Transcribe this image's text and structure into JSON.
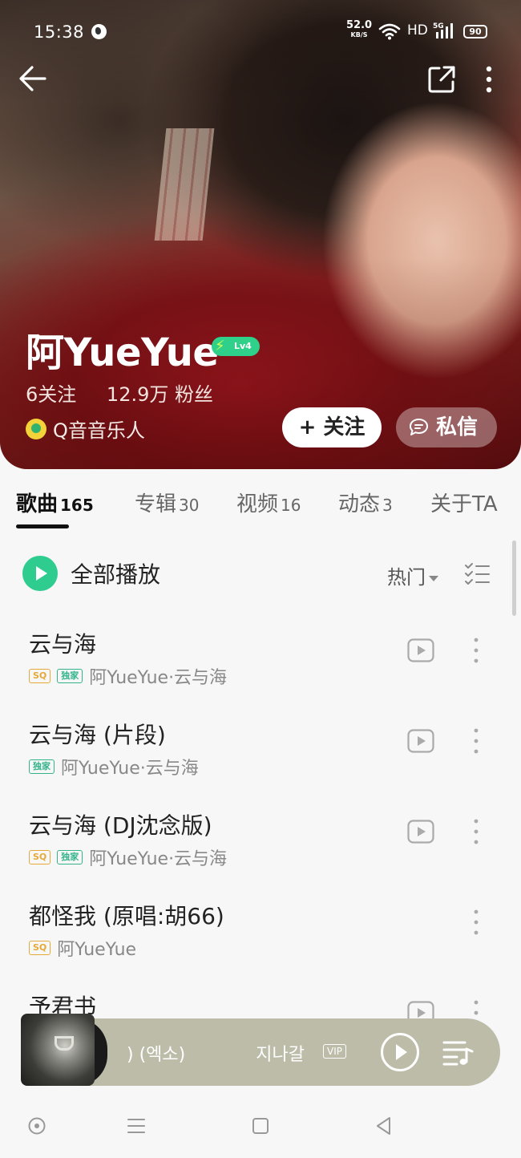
{
  "status_bar": {
    "time": "15:38",
    "net_speed": "52.0",
    "net_speed_unit": "KB/S",
    "hd": "HD",
    "signal": "5G",
    "battery": "90"
  },
  "profile": {
    "name": "阿YueYue",
    "level": "Lv4",
    "following": "6关注",
    "fans": "12.9万 粉丝",
    "musician_label": "Q音音乐人",
    "follow_label": "+ 关注",
    "message_label": "私信"
  },
  "tabs": [
    {
      "label": "歌曲",
      "count": "165",
      "active": true
    },
    {
      "label": "专辑",
      "count": "30"
    },
    {
      "label": "视频",
      "count": "16"
    },
    {
      "label": "动态",
      "count": "3"
    },
    {
      "label": "关于TA",
      "count": ""
    }
  ],
  "list_header": {
    "play_all": "全部播放",
    "sort": "热门"
  },
  "songs": [
    {
      "title": "云与海",
      "tags": [
        "SQ",
        "独家"
      ],
      "meta": "阿YueYue·云与海",
      "mv": true
    },
    {
      "title": "云与海 (片段)",
      "tags": [
        "独家"
      ],
      "meta": "阿YueYue·云与海",
      "mv": true
    },
    {
      "title": "云与海 (DJ沈念版)",
      "tags": [
        "SQ",
        "独家"
      ],
      "meta": "阿YueYue·云与海",
      "mv": true
    },
    {
      "title": "都怪我 (原唱:胡66)",
      "tags": [
        "SQ"
      ],
      "meta": "阿YueYue",
      "mv": false
    },
    {
      "title": "予君书",
      "tags": [],
      "meta": "",
      "mv": true
    }
  ],
  "mini_player": {
    "title_fragment": ") (엑소)",
    "artist_fragment": "지나갈",
    "vip": "VIP"
  },
  "colors": {
    "accent_green": "#2ecc8f",
    "sq_tag": "#e5a93a",
    "exclusive_tag": "#33b38a",
    "level_badge": "#2fd18a",
    "mini_player_bg": "#bdbca9"
  },
  "icons": {
    "back": "arrow-left",
    "share": "external-link",
    "more": "vertical-dots",
    "message": "chat-bubble",
    "play": "triangle-play",
    "mv": "video-play",
    "playlist": "music-list"
  }
}
